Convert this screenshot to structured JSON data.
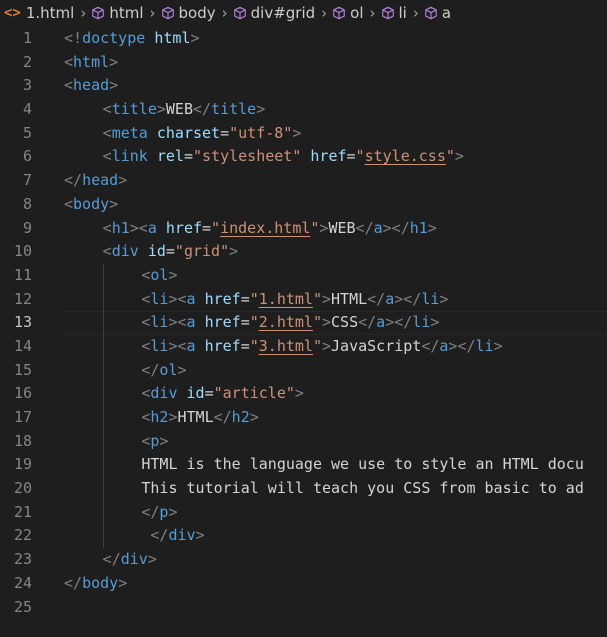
{
  "breadcrumb": [
    {
      "label": "1.html",
      "icon": "html-file-icon"
    },
    {
      "label": "html",
      "icon": "cube-icon"
    },
    {
      "label": "body",
      "icon": "cube-icon"
    },
    {
      "label": "div#grid",
      "icon": "cube-icon"
    },
    {
      "label": "ol",
      "icon": "cube-icon"
    },
    {
      "label": "li",
      "icon": "cube-icon"
    },
    {
      "label": "a",
      "icon": "cube-icon"
    }
  ],
  "current_line": 13,
  "lines": [
    {
      "n": "1",
      "indent": 0,
      "tokens": [
        [
          "p",
          "<!"
        ],
        [
          "t",
          "doctype"
        ],
        [
          "x",
          " "
        ],
        [
          "a",
          "html"
        ],
        [
          "p",
          ">"
        ]
      ]
    },
    {
      "n": "2",
      "indent": 0,
      "tokens": [
        [
          "p",
          "<"
        ],
        [
          "t",
          "html"
        ],
        [
          "p",
          ">"
        ]
      ]
    },
    {
      "n": "3",
      "indent": 0,
      "tokens": [
        [
          "p",
          "<"
        ],
        [
          "t",
          "head"
        ],
        [
          "p",
          ">"
        ]
      ]
    },
    {
      "n": "4",
      "indent": 1,
      "tokens": [
        [
          "p",
          "<"
        ],
        [
          "t",
          "title"
        ],
        [
          "p",
          ">"
        ],
        [
          "x",
          "WEB"
        ],
        [
          "p",
          "</"
        ],
        [
          "t",
          "title"
        ],
        [
          "p",
          ">"
        ]
      ]
    },
    {
      "n": "5",
      "indent": 1,
      "tokens": [
        [
          "p",
          "<"
        ],
        [
          "t",
          "meta"
        ],
        [
          "x",
          " "
        ],
        [
          "a",
          "charset"
        ],
        [
          "x",
          "="
        ],
        [
          "s",
          "\"utf-8\""
        ],
        [
          "p",
          ">"
        ]
      ]
    },
    {
      "n": "6",
      "indent": 1,
      "tokens": [
        [
          "p",
          "<"
        ],
        [
          "t",
          "link"
        ],
        [
          "x",
          " "
        ],
        [
          "a",
          "rel"
        ],
        [
          "x",
          "="
        ],
        [
          "s",
          "\"stylesheet\""
        ],
        [
          "x",
          " "
        ],
        [
          "a",
          "href"
        ],
        [
          "x",
          "="
        ],
        [
          "s",
          "\""
        ],
        [
          "su",
          "style.css"
        ],
        [
          "s",
          "\""
        ],
        [
          "p",
          ">"
        ]
      ]
    },
    {
      "n": "7",
      "indent": 0,
      "tokens": [
        [
          "p",
          "</"
        ],
        [
          "t",
          "head"
        ],
        [
          "p",
          ">"
        ]
      ]
    },
    {
      "n": "8",
      "indent": 0,
      "tokens": [
        [
          "p",
          "<"
        ],
        [
          "t",
          "body"
        ],
        [
          "p",
          ">"
        ]
      ]
    },
    {
      "n": "9",
      "indent": 1,
      "tokens": [
        [
          "p",
          "<"
        ],
        [
          "t",
          "h1"
        ],
        [
          "p",
          ">"
        ],
        [
          "p",
          "<"
        ],
        [
          "t",
          "a"
        ],
        [
          "x",
          " "
        ],
        [
          "a",
          "href"
        ],
        [
          "x",
          "="
        ],
        [
          "s",
          "\""
        ],
        [
          "su",
          "index.html"
        ],
        [
          "s",
          "\""
        ],
        [
          "p",
          ">"
        ],
        [
          "x",
          "WEB"
        ],
        [
          "p",
          "</"
        ],
        [
          "t",
          "a"
        ],
        [
          "p",
          ">"
        ],
        [
          "p",
          "</"
        ],
        [
          "t",
          "h1"
        ],
        [
          "p",
          ">"
        ]
      ]
    },
    {
      "n": "10",
      "indent": 1,
      "tokens": [
        [
          "p",
          "<"
        ],
        [
          "t",
          "div"
        ],
        [
          "x",
          " "
        ],
        [
          "a",
          "id"
        ],
        [
          "x",
          "="
        ],
        [
          "s",
          "\"grid\""
        ],
        [
          "p",
          ">"
        ]
      ]
    },
    {
      "n": "11",
      "indent": 2,
      "tokens": [
        [
          "p",
          "<"
        ],
        [
          "t",
          "ol"
        ],
        [
          "p",
          ">"
        ]
      ]
    },
    {
      "n": "12",
      "indent": 2,
      "tokens": [
        [
          "p",
          "<"
        ],
        [
          "t",
          "li"
        ],
        [
          "p",
          ">"
        ],
        [
          "p",
          "<"
        ],
        [
          "t",
          "a"
        ],
        [
          "x",
          " "
        ],
        [
          "a",
          "href"
        ],
        [
          "x",
          "="
        ],
        [
          "s",
          "\""
        ],
        [
          "su",
          "1.html"
        ],
        [
          "s",
          "\""
        ],
        [
          "p",
          ">"
        ],
        [
          "x",
          "HTML"
        ],
        [
          "p",
          "</"
        ],
        [
          "t",
          "a"
        ],
        [
          "p",
          ">"
        ],
        [
          "p",
          "</"
        ],
        [
          "t",
          "li"
        ],
        [
          "p",
          ">"
        ]
      ]
    },
    {
      "n": "13",
      "indent": 2,
      "tokens": [
        [
          "p",
          "<"
        ],
        [
          "t",
          "li"
        ],
        [
          "p",
          ">"
        ],
        [
          "p",
          "<"
        ],
        [
          "t",
          "a"
        ],
        [
          "x",
          " "
        ],
        [
          "a",
          "href"
        ],
        [
          "x",
          "="
        ],
        [
          "s",
          "\""
        ],
        [
          "su",
          "2.html"
        ],
        [
          "s",
          "\""
        ],
        [
          "p",
          ">"
        ],
        [
          "x",
          "CSS"
        ],
        [
          "p",
          "</"
        ],
        [
          "t",
          "a"
        ],
        [
          "p",
          ">"
        ],
        [
          "p",
          "</"
        ],
        [
          "t",
          "li"
        ],
        [
          "p",
          ">"
        ]
      ]
    },
    {
      "n": "14",
      "indent": 2,
      "tokens": [
        [
          "p",
          "<"
        ],
        [
          "t",
          "li"
        ],
        [
          "p",
          ">"
        ],
        [
          "p",
          "<"
        ],
        [
          "t",
          "a"
        ],
        [
          "x",
          " "
        ],
        [
          "a",
          "href"
        ],
        [
          "x",
          "="
        ],
        [
          "s",
          "\""
        ],
        [
          "su",
          "3.html"
        ],
        [
          "s",
          "\""
        ],
        [
          "p",
          ">"
        ],
        [
          "x",
          "JavaScript"
        ],
        [
          "p",
          "</"
        ],
        [
          "t",
          "a"
        ],
        [
          "p",
          ">"
        ],
        [
          "p",
          "</"
        ],
        [
          "t",
          "li"
        ],
        [
          "p",
          ">"
        ]
      ]
    },
    {
      "n": "15",
      "indent": 2,
      "tokens": [
        [
          "p",
          "</"
        ],
        [
          "t",
          "ol"
        ],
        [
          "p",
          ">"
        ]
      ]
    },
    {
      "n": "16",
      "indent": 2,
      "tokens": [
        [
          "p",
          "<"
        ],
        [
          "t",
          "div"
        ],
        [
          "x",
          " "
        ],
        [
          "a",
          "id"
        ],
        [
          "x",
          "="
        ],
        [
          "s",
          "\"article\""
        ],
        [
          "p",
          ">"
        ]
      ]
    },
    {
      "n": "17",
      "indent": 2,
      "tokens": [
        [
          "p",
          "<"
        ],
        [
          "t",
          "h2"
        ],
        [
          "p",
          ">"
        ],
        [
          "x",
          "HTML"
        ],
        [
          "p",
          "</"
        ],
        [
          "t",
          "h2"
        ],
        [
          "p",
          ">"
        ]
      ]
    },
    {
      "n": "18",
      "indent": 2,
      "tokens": [
        [
          "p",
          "<"
        ],
        [
          "t",
          "p"
        ],
        [
          "p",
          ">"
        ]
      ]
    },
    {
      "n": "19",
      "indent": 2,
      "tokens": [
        [
          "x",
          "HTML is the language we use to style an HTML docu"
        ]
      ]
    },
    {
      "n": "20",
      "indent": 2,
      "tokens": [
        [
          "x",
          "This tutorial will teach you CSS from basic to ad"
        ]
      ]
    },
    {
      "n": "21",
      "indent": 2,
      "tokens": [
        [
          "p",
          "</"
        ],
        [
          "t",
          "p"
        ],
        [
          "p",
          ">"
        ]
      ]
    },
    {
      "n": "22",
      "indent": 2,
      "tokens": [
        [
          "x",
          " "
        ],
        [
          "p",
          "</"
        ],
        [
          "t",
          "div"
        ],
        [
          "p",
          ">"
        ]
      ]
    },
    {
      "n": "23",
      "indent": 1,
      "tokens": [
        [
          "p",
          "</"
        ],
        [
          "t",
          "div"
        ],
        [
          "p",
          ">"
        ]
      ]
    },
    {
      "n": "24",
      "indent": 0,
      "tokens": [
        [
          "p",
          "</"
        ],
        [
          "t",
          "body"
        ],
        [
          "p",
          ">"
        ]
      ]
    },
    {
      "n": "25",
      "indent": 0,
      "tokens": []
    }
  ]
}
